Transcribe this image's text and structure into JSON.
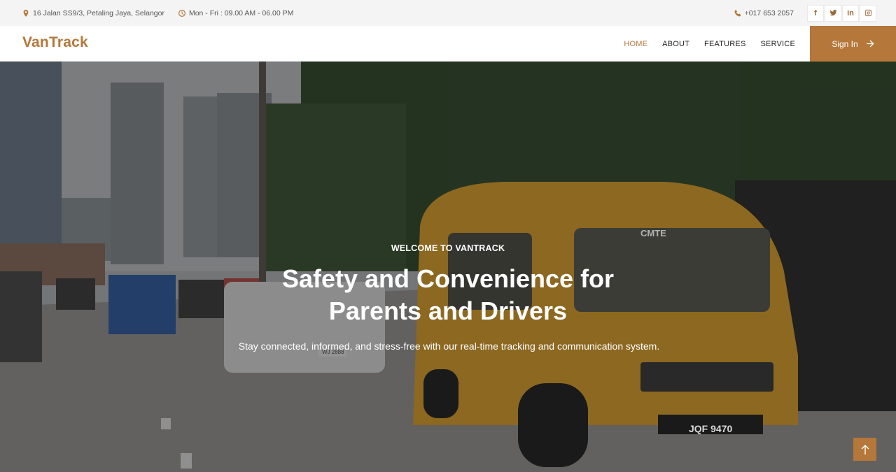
{
  "topbar": {
    "address": "16 Jalan SS9/3, Petaling Jaya, Selangor",
    "hours": "Mon - Fri : 09.00 AM - 06.00 PM",
    "phone": "+017 653 2057",
    "social": {
      "facebook": "f",
      "twitter": "twitter-icon",
      "linkedin": "in",
      "instagram": "instagram-icon"
    }
  },
  "nav": {
    "brand": "VanTrack",
    "items": [
      {
        "label": "HOME",
        "active": true
      },
      {
        "label": "ABOUT"
      },
      {
        "label": "FEATURES"
      },
      {
        "label": "SERVICE"
      }
    ],
    "signin": "Sign In"
  },
  "hero": {
    "eyebrow": "WELCOME TO VANTRACK",
    "headline": "Safety and Convenience for Parents and Drivers",
    "subtext": "Stay connected, informed, and stress-free with our real-time tracking and communication system.",
    "van_plate": "JQF 9470",
    "van_label": "CMTE",
    "car_plate": "WJ 2888"
  },
  "colors": {
    "accent": "#b5773a",
    "topbar_bg": "#f4f4f4"
  }
}
